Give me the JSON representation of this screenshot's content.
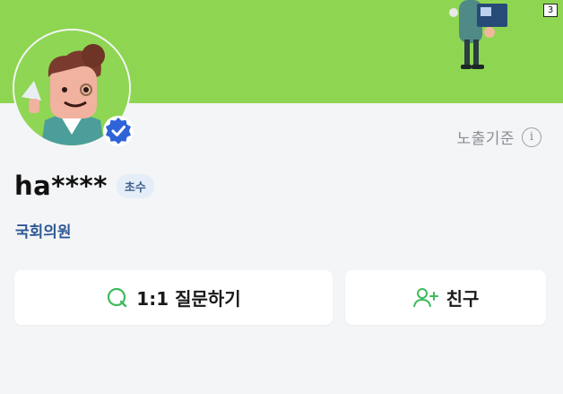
{
  "page_number": "3",
  "exposure": {
    "label": "노출기준",
    "info_glyph": "i"
  },
  "profile": {
    "username": "ha****",
    "grade_badge": "초수",
    "role": "국회의원"
  },
  "actions": {
    "question_label": "1:1 질문하기",
    "friend_label": "친구"
  },
  "icons": {
    "question": "q-question-icon",
    "friend": "add-person-icon",
    "verified": "verified-check-icon",
    "info": "info-icon"
  },
  "colors": {
    "banner": "#8ed651",
    "accent_green": "#3dbb5c",
    "verified_blue": "#2f63d8",
    "role_text": "#2e5894",
    "badge_bg": "#e4edf8"
  }
}
